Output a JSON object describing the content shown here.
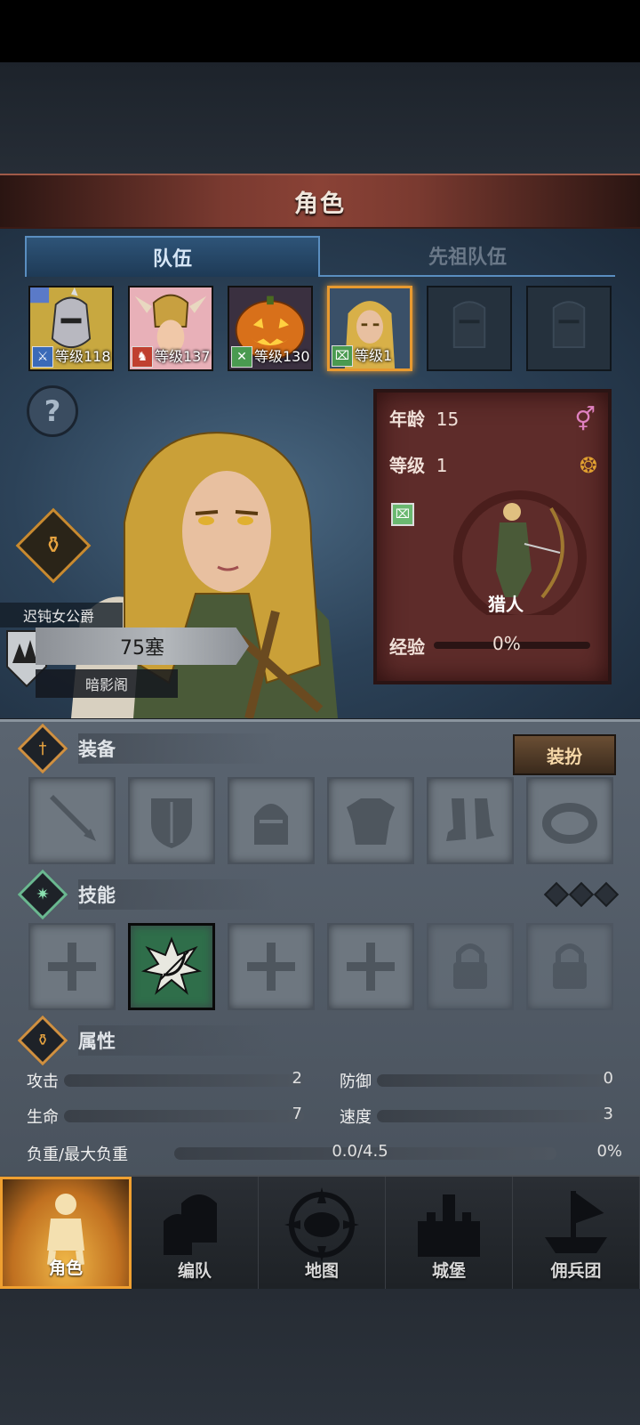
{
  "header": {
    "title": "角色"
  },
  "tabs": [
    {
      "label": "队伍",
      "active": true
    },
    {
      "label": "先祖队伍",
      "active": false
    }
  ],
  "team": [
    {
      "level_text": "等级118",
      "class_color": "#3a6ab8",
      "class_icon": "sword-icon",
      "selected": false
    },
    {
      "level_text": "等级137",
      "class_color": "#c04030",
      "class_icon": "horse-icon",
      "selected": false
    },
    {
      "level_text": "等级130",
      "class_color": "#4a9a50",
      "class_icon": "crossed-weapons-icon",
      "selected": false
    },
    {
      "level_text": "等级1",
      "class_color": "#4a9a50",
      "class_icon": "bow-icon",
      "selected": true
    },
    {
      "empty": true
    },
    {
      "empty": true
    }
  ],
  "character": {
    "title": "迟钝女公爵",
    "fortress": "75塞",
    "guild": "暗影阁",
    "age_label": "年龄",
    "age": "15",
    "level_label": "等级",
    "level": "1",
    "class_name": "猎人",
    "exp_label": "经验",
    "exp_value": "0%",
    "exp_fraction": 0
  },
  "equipment": {
    "title": "装备",
    "dress_button": "装扮",
    "slots": [
      "sword-icon",
      "shield-icon",
      "helmet-icon",
      "armor-icon",
      "boots-icon",
      "ring-icon"
    ]
  },
  "skills": {
    "title": "技能",
    "slots": [
      {
        "state": "empty"
      },
      {
        "state": "active",
        "icon": "bow-shot-icon"
      },
      {
        "state": "empty"
      },
      {
        "state": "empty"
      },
      {
        "state": "locked"
      },
      {
        "state": "locked"
      }
    ]
  },
  "attributes": {
    "title": "属性",
    "attack_label": "攻击",
    "attack": "2",
    "defense_label": "防御",
    "defense": "0",
    "hp_label": "生命",
    "hp": "7",
    "speed_label": "速度",
    "speed": "3",
    "load_label": "负重/最大负重",
    "load": "0.0/4.5",
    "load_pct": "0%"
  },
  "nav": [
    {
      "label": "角色",
      "active": true
    },
    {
      "label": "编队",
      "active": false
    },
    {
      "label": "地图",
      "active": false
    },
    {
      "label": "城堡",
      "active": false
    },
    {
      "label": "佣兵团",
      "active": false
    }
  ],
  "colors": {
    "accent": "#e89a30",
    "title_bar": "#7a3a30",
    "tab_active": "#2e5478"
  }
}
